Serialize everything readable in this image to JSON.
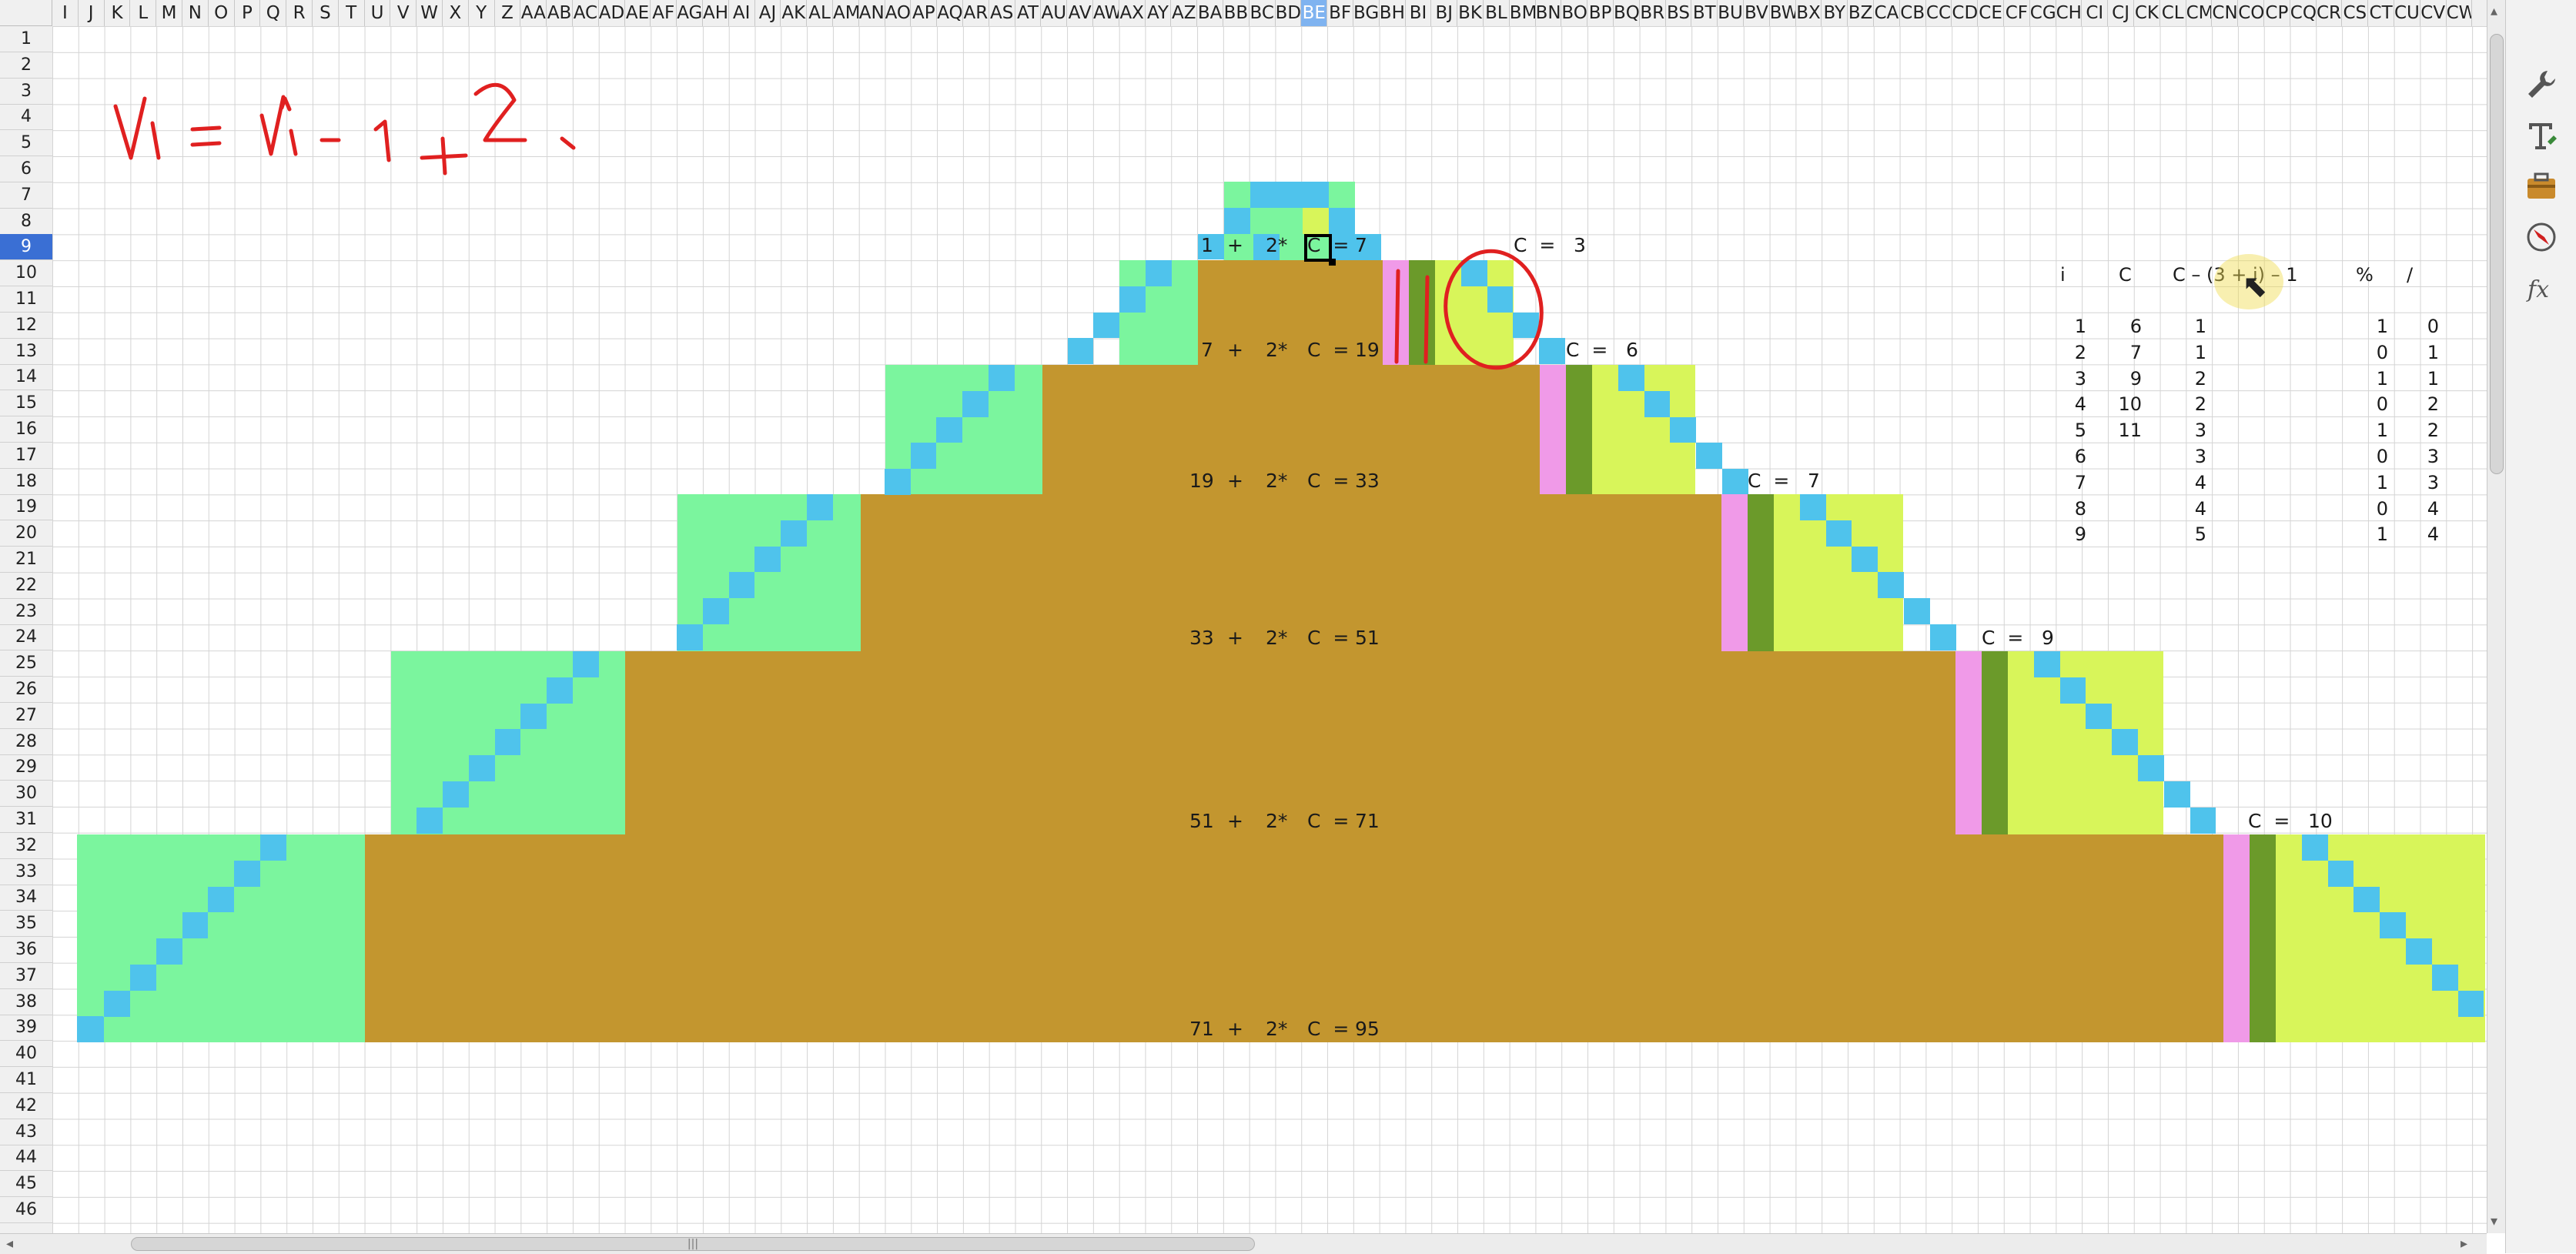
{
  "columns": [
    "I",
    "J",
    "K",
    "L",
    "M",
    "N",
    "O",
    "P",
    "Q",
    "R",
    "S",
    "T",
    "U",
    "V",
    "W",
    "X",
    "Y",
    "Z",
    "AA",
    "AB",
    "AC",
    "AD",
    "AE",
    "AF",
    "AG",
    "AH",
    "AI",
    "AJ",
    "AK",
    "AL",
    "AM",
    "AN",
    "AO",
    "AP",
    "AQ",
    "AR",
    "AS",
    "AT",
    "AU",
    "AV",
    "AW",
    "AX",
    "AY",
    "AZ",
    "BA",
    "BB",
    "BC",
    "BD",
    "BE",
    "BF",
    "BG",
    "BH",
    "BI",
    "BJ",
    "BK",
    "BL",
    "BM",
    "BN",
    "BO",
    "BP",
    "BQ",
    "BR",
    "BS",
    "BT",
    "BU",
    "BV",
    "BW",
    "BX",
    "BY",
    "BZ",
    "CA",
    "CB",
    "CC",
    "CD",
    "CE",
    "CF",
    "CG",
    "CH",
    "CI",
    "CJ",
    "CK",
    "CL",
    "CM",
    "CN",
    "CO",
    "CP",
    "CQ",
    "CR",
    "CS",
    "CT",
    "CU",
    "CV",
    "CW"
  ],
  "selected_column": "BE",
  "selected_row": "9",
  "rows": [
    "1",
    "2",
    "3",
    "4",
    "5",
    "6",
    "7",
    "8",
    "9",
    "10",
    "11",
    "12",
    "13",
    "14",
    "15",
    "16",
    "17",
    "18",
    "19",
    "20",
    "21",
    "22",
    "23",
    "24",
    "25",
    "26",
    "27",
    "28",
    "29",
    "30",
    "31",
    "32",
    "33",
    "34",
    "35",
    "36",
    "37",
    "38",
    "39",
    "40",
    "41",
    "42",
    "43",
    "44",
    "45",
    "46"
  ],
  "handwriting": "Vi = Vi-1 + 2i",
  "formulas": [
    {
      "prev": "1",
      "plus": "+",
      "mult": "2*",
      "eq": "C  =",
      "result": "7"
    },
    {
      "prev": "7",
      "plus": "+",
      "mult": "2*",
      "eq": "C  =",
      "result": "19"
    },
    {
      "prev": "19",
      "plus": "+",
      "mult": "2*",
      "eq": "C  =",
      "result": "33"
    },
    {
      "prev": "33",
      "plus": "+",
      "mult": "2*",
      "eq": "C  =",
      "result": "51"
    },
    {
      "prev": "51",
      "plus": "+",
      "mult": "2*",
      "eq": "C  =",
      "result": "71"
    },
    {
      "prev": "71",
      "plus": "+",
      "mult": "2*",
      "eq": "C  =",
      "result": "95"
    }
  ],
  "c_labels": [
    {
      "label": "C  =",
      "value": "3"
    },
    {
      "label": "C  =",
      "value": "6"
    },
    {
      "label": "C  =",
      "value": "7"
    },
    {
      "label": "C  =",
      "value": "9"
    },
    {
      "label": "C  =",
      "value": "10"
    }
  ],
  "table": {
    "headers": {
      "i": "i",
      "c": "C",
      "formula": "C – (3 + i) – 1",
      "mod": "%",
      "div": "/"
    },
    "rows": [
      {
        "i": "1",
        "c": "6",
        "f": "1",
        "mod": "1",
        "div": "0"
      },
      {
        "i": "2",
        "c": "7",
        "f": "1",
        "mod": "0",
        "div": "1"
      },
      {
        "i": "3",
        "c": "9",
        "f": "2",
        "mod": "1",
        "div": "1"
      },
      {
        "i": "4",
        "c": "10",
        "f": "2",
        "mod": "0",
        "div": "2"
      },
      {
        "i": "5",
        "c": "11",
        "f": "3",
        "mod": "1",
        "div": "2"
      },
      {
        "i": "6",
        "c": "",
        "f": "3",
        "mod": "0",
        "div": "3"
      },
      {
        "i": "7",
        "c": "",
        "f": "4",
        "mod": "1",
        "div": "3"
      },
      {
        "i": "8",
        "c": "",
        "f": "4",
        "mod": "0",
        "div": "4"
      },
      {
        "i": "9",
        "c": "",
        "f": "5",
        "mod": "1",
        "div": "4"
      }
    ]
  },
  "colors": {
    "brown": "#c3962f",
    "green": "#7bf59e",
    "blue": "#4fc3ec",
    "yellow_green": "#d8f55a",
    "pink": "#f09ae8",
    "dark_green": "#6b9a2a",
    "annotation_red": "#e02020",
    "grid": "#d4d4d4"
  },
  "sidebar_icons": [
    "wrench-icon",
    "text-t-icon",
    "gallery-icon",
    "navigator-icon",
    "function-fx-icon"
  ]
}
